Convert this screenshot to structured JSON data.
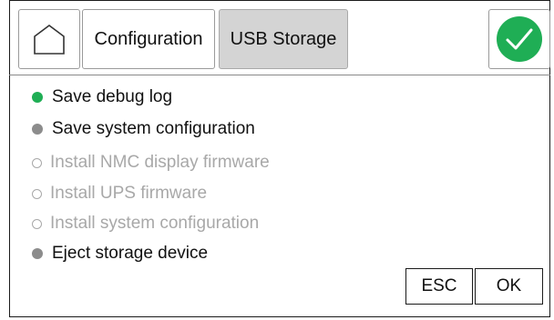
{
  "toolbar": {
    "home_icon": "home-icon",
    "configuration_label": "Configuration",
    "usb_storage_label": "USB Storage",
    "confirm_icon": "checkmark-icon",
    "accent_color": "#1fae55",
    "selected_tab_bg": "#d4d4d4"
  },
  "menu": {
    "items": [
      {
        "label": "Save debug log",
        "state": "selected"
      },
      {
        "label": "Save system configuration",
        "state": "enabled"
      },
      {
        "label": "Install NMC display firmware",
        "state": "disabled"
      },
      {
        "label": "Install UPS firmware",
        "state": "disabled"
      },
      {
        "label": "Install system configuration",
        "state": "disabled"
      },
      {
        "label": "Eject storage device",
        "state": "enabled"
      }
    ]
  },
  "actions": {
    "esc_label": "ESC",
    "ok_label": "OK"
  }
}
